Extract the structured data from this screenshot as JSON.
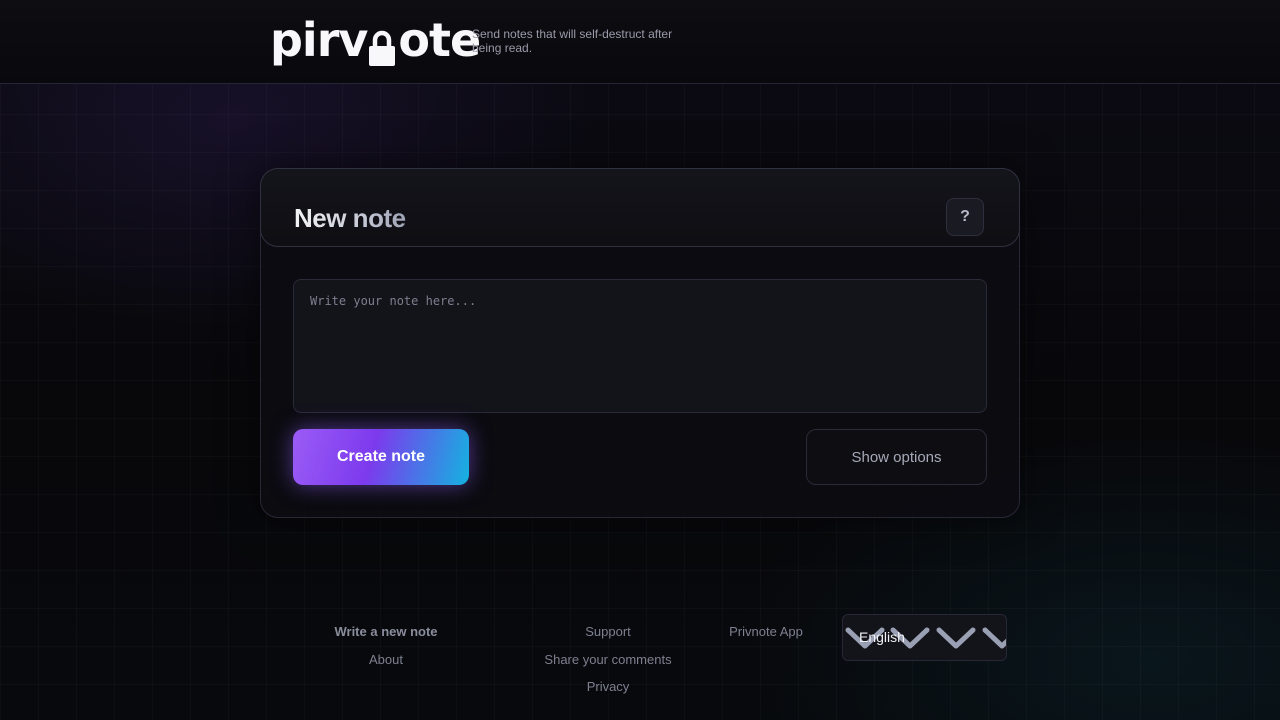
{
  "header": {
    "logo_text_left": "pirv",
    "logo_text_right": "ote",
    "tagline": "Send notes that will self-destruct after being read."
  },
  "card": {
    "title": "New note",
    "help_label": "?",
    "note_placeholder": "Write your note here...",
    "note_value": "",
    "create_label": "Create note",
    "options_label": "Show options"
  },
  "footer": {
    "links": [
      "Write a new note",
      "About",
      "Support",
      "Share your comments",
      "Privacy",
      "Privnote App"
    ],
    "language": "English"
  },
  "colors": {
    "accent_start": "#9a5cf6",
    "accent_mid": "#7c3aed",
    "accent_end": "#14b3e0",
    "background": "#08080c"
  },
  "icons": {
    "logo_lock": "lock-icon",
    "language_dropdown": "chevron-down-icon"
  }
}
